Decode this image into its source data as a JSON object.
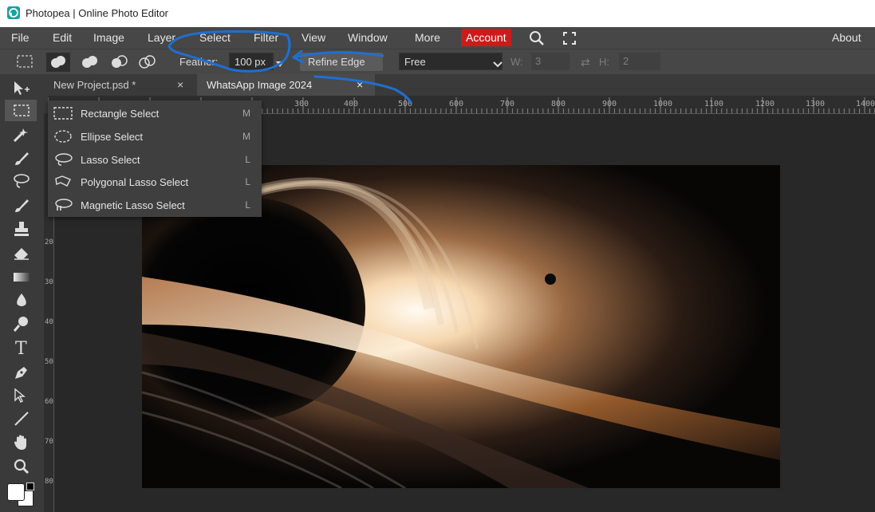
{
  "window": {
    "title": "Photopea | Online Photo Editor"
  },
  "menu": {
    "items": [
      "File",
      "Edit",
      "Image",
      "Layer",
      "Select",
      "Filter",
      "View",
      "Window",
      "More"
    ],
    "account": "Account",
    "about": "About"
  },
  "options": {
    "feather_label": "Feather:",
    "feather_value": "100 px",
    "refine_edge": "Refine Edge",
    "style_value": "Free",
    "width_label": "W:",
    "width_value": "3",
    "height_label": "H:",
    "height_value": "2"
  },
  "tabs": [
    {
      "label": "New Project.psd *",
      "close": "×"
    },
    {
      "label": "WhatsApp Image 2024",
      "close": "×"
    }
  ],
  "ruler": {
    "top": [
      "300",
      "400",
      "500",
      "600",
      "700",
      "800",
      "900",
      "1000",
      "1100",
      "1200",
      "1300",
      "1400"
    ],
    "left": [
      "200",
      "300",
      "400",
      "500",
      "600",
      "700",
      "800"
    ]
  },
  "tool_menu": [
    {
      "label": "Rectangle Select",
      "key": "M",
      "icon": "rectangle-select-icon"
    },
    {
      "label": "Ellipse Select",
      "key": "M",
      "icon": "ellipse-select-icon"
    },
    {
      "label": "Lasso Select",
      "key": "L",
      "icon": "lasso-icon"
    },
    {
      "label": "Polygonal Lasso Select",
      "key": "L",
      "icon": "polygonal-lasso-icon"
    },
    {
      "label": "Magnetic Lasso Select",
      "key": "L",
      "icon": "magnetic-lasso-icon"
    }
  ],
  "colors": {
    "account_bg": "#cc1b1b",
    "annotation_stroke": "#1f6fd1",
    "logo": "#19a0a0"
  }
}
